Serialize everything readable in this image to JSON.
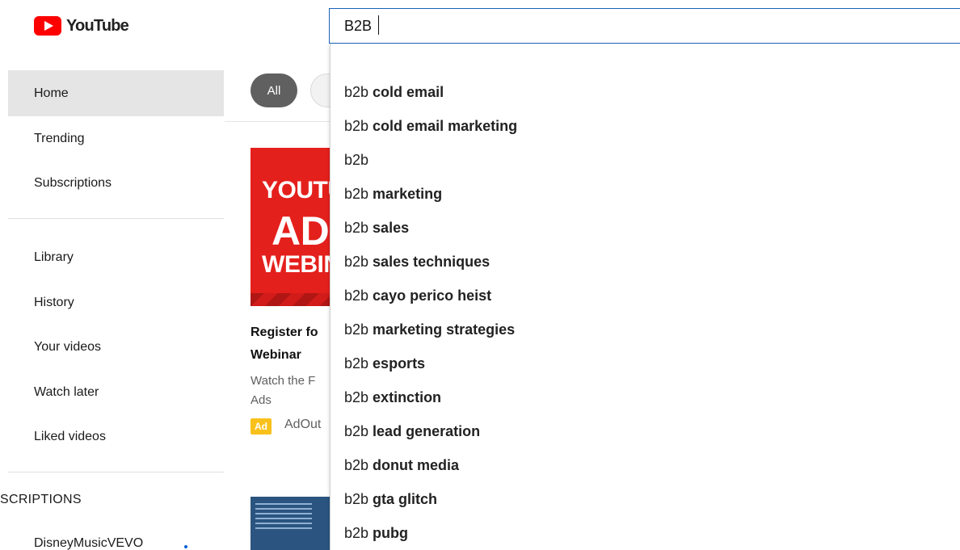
{
  "logo": {
    "text": "YouTube"
  },
  "search": {
    "value": "B2B"
  },
  "sidebar": {
    "primary": [
      {
        "label": "Home",
        "active": true
      },
      {
        "label": "Trending"
      },
      {
        "label": "Subscriptions"
      }
    ],
    "secondary": [
      {
        "label": "Library"
      },
      {
        "label": "History"
      },
      {
        "label": "Your videos"
      },
      {
        "label": "Watch later"
      },
      {
        "label": "Liked videos"
      }
    ],
    "subscriptions_title": "SCRIPTIONS",
    "subscriptions": [
      {
        "label": "DisneyMusicVEVO",
        "new_content": true
      }
    ]
  },
  "chips": {
    "first": "All"
  },
  "ad_video": {
    "thumbnail_lines": [
      "YOUTU",
      "ADS",
      "WEBIN"
    ],
    "title_lines": [
      "Register fo",
      "Webinar"
    ],
    "desc_lines": [
      "Watch the F",
      "Ads"
    ],
    "badge": "Ad",
    "channel": "AdOut"
  },
  "suggestions": [
    {
      "prefix": "b2b",
      "rest": " cold email"
    },
    {
      "prefix": "b2b",
      "rest": " cold email marketing"
    },
    {
      "prefix": "b2b",
      "rest": ""
    },
    {
      "prefix": "b2b",
      "rest": " marketing"
    },
    {
      "prefix": "b2b",
      "rest": " sales"
    },
    {
      "prefix": "b2b",
      "rest": " sales techniques"
    },
    {
      "prefix": "b2b",
      "rest": " cayo perico heist"
    },
    {
      "prefix": "b2b",
      "rest": " marketing strategies"
    },
    {
      "prefix": "b2b",
      "rest": " esports"
    },
    {
      "prefix": "b2b",
      "rest": " extinction"
    },
    {
      "prefix": "b2b",
      "rest": " lead generation"
    },
    {
      "prefix": "b2b",
      "rest": " donut media"
    },
    {
      "prefix": "b2b",
      "rest": " gta glitch"
    },
    {
      "prefix": "b2b",
      "rest": " pubg"
    }
  ],
  "colors": {
    "brand_red": "#ff0000",
    "focus_blue": "#1c62b9",
    "ad_yellow": "#f9c11b"
  }
}
